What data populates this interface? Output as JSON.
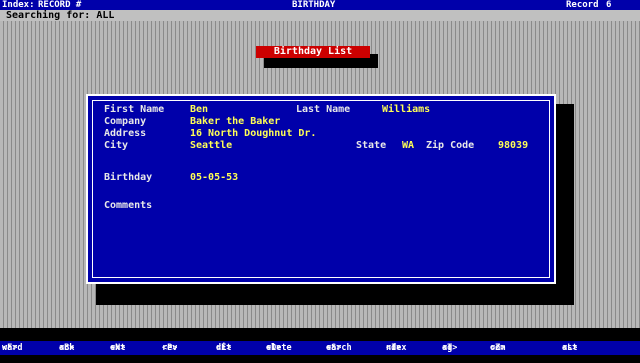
{
  "topbar": {
    "index_label": "Index:",
    "index_value": "RECORD #",
    "file_name": "BIRTHDAY",
    "record_label": "Record",
    "record_number": "6"
  },
  "search": {
    "label": "Searching for:",
    "value": "ALL"
  },
  "form_title": "Birthday List",
  "record": {
    "first_name": {
      "label": "First Name",
      "value": "Ben"
    },
    "last_name": {
      "label": "Last Name",
      "value": "Williams"
    },
    "company": {
      "label": "Company",
      "value": "Baker the Baker"
    },
    "address": {
      "label": "Address",
      "value": "16 North Doughnut Dr."
    },
    "city": {
      "label": "City",
      "value": "Seattle"
    },
    "state": {
      "label": "State",
      "value": "WA"
    },
    "zip": {
      "label": "Zip Code",
      "value": "98039"
    },
    "birthday": {
      "label": "Birthday",
      "value": "05-05-53"
    },
    "comments": {
      "label": "Comments",
      "value": ""
    }
  },
  "commands": [
    {
      "key": "<F>",
      "label": "ward"
    },
    {
      "key": "<B>",
      "label": "ack"
    },
    {
      "key": "<N>",
      "label": "ext"
    },
    {
      "key": "<P>",
      "label": "rev"
    },
    {
      "key": "<E>",
      "label": "dit"
    },
    {
      "key": "<D>",
      "label": "elete"
    },
    {
      "key": "<S>",
      "label": "earch"
    },
    {
      "key": "<I>",
      "label": "ndex"
    },
    {
      "key": "<T>",
      "label": "ag"
    },
    {
      "key": "<Z>",
      "label": "oom"
    },
    {
      "key": "<L>",
      "label": "ast"
    }
  ],
  "colors": {
    "bar_blue": "#0000aa",
    "form_blue": "#0000aa",
    "title_red": "#cc0000",
    "value_yellow": "#ffff55"
  }
}
